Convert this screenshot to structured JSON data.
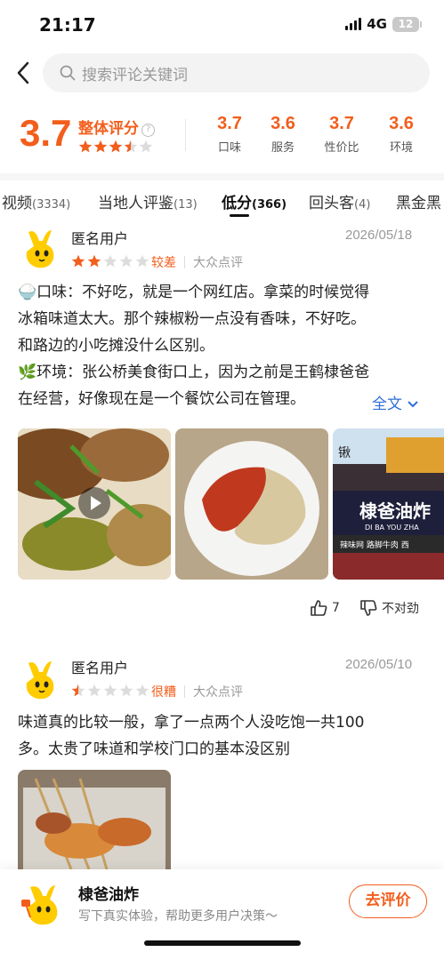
{
  "status": {
    "time": "21:17",
    "network": "4G",
    "battery": "12"
  },
  "search": {
    "placeholder": "搜索评论关键词"
  },
  "rating": {
    "overall_value": "3.7",
    "overall_label": "整体评分",
    "overall_stars": 3.5,
    "sub_scores": [
      {
        "value": "3.7",
        "label": "口味"
      },
      {
        "value": "3.6",
        "label": "服务"
      },
      {
        "value": "3.7",
        "label": "性价比"
      },
      {
        "value": "3.6",
        "label": "环境"
      }
    ]
  },
  "tabs": [
    {
      "label": "视频",
      "count": "(3334)"
    },
    {
      "label": "当地人评鉴",
      "count": "(13)"
    },
    {
      "label": "低分",
      "count": "(366)",
      "active": true
    },
    {
      "label": "回头客",
      "count": "(4)"
    },
    {
      "label": "黑金黑",
      "count": ""
    }
  ],
  "reviews": [
    {
      "user": "匿名用户",
      "date": "2026/05/18",
      "stars": 2,
      "level": "较差",
      "source": "大众点评",
      "lines": [
        "🍚口味：不好吃，就是一个网红店。拿菜的时候觉得",
        "冰箱味道太大。那个辣椒粉一点没有香味，不好吃。",
        "和路边的小吃摊没什么区别。",
        "🌿环境：张公桥美食街口上，因为之前是王鹤棣爸爸",
        "在经营，好像现在是一个餐饮公司在管理。"
      ],
      "more": "全文",
      "photo_sign": {
        "big": "棣爸油炸",
        "pinyin": "DI BA YOU ZHA",
        "small": "辣味网 路脚牛肉 西",
        "top": "锹"
      },
      "likes": "7",
      "dislike": "不对劲"
    },
    {
      "user": "匿名用户",
      "date": "2026/05/10",
      "stars": 0.5,
      "level": "很糟",
      "source": "大众点评",
      "lines": [
        "味道真的比较一般，拿了一点两个人没吃饱一共100",
        "多。太贵了味道和学校门口的基本没区别"
      ]
    }
  ],
  "bottom": {
    "shop": "棣爸油炸",
    "sub": "写下真实体验，帮助更多用户决策～",
    "button": "去评价"
  },
  "colors": {
    "accent": "#f25e1c",
    "link": "#2f6fd6",
    "star_off": "#dcdcdc"
  }
}
